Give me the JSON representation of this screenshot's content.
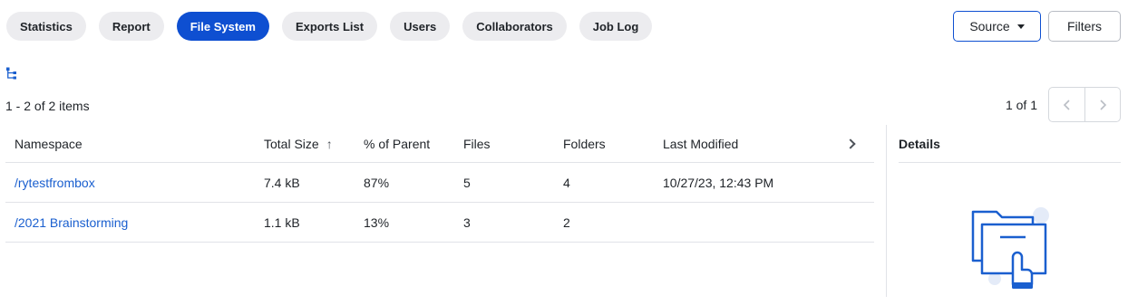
{
  "tabs": [
    {
      "label": "Statistics",
      "active": false
    },
    {
      "label": "Report",
      "active": false
    },
    {
      "label": "File System",
      "active": true
    },
    {
      "label": "Exports List",
      "active": false
    },
    {
      "label": "Users",
      "active": false
    },
    {
      "label": "Collaborators",
      "active": false
    },
    {
      "label": "Job Log",
      "active": false
    }
  ],
  "toolbar": {
    "source_label": "Source",
    "filters_label": "Filters"
  },
  "list": {
    "count_text": "1 - 2 of 2 items",
    "page_text": "1 of 1"
  },
  "table": {
    "columns": [
      "Namespace",
      "Total Size",
      "% of Parent",
      "Files",
      "Folders",
      "Last Modified"
    ],
    "rows": [
      {
        "namespace": "/rytestfrombox",
        "size": "7.4 kB",
        "pct": "87%",
        "files": "5",
        "folders": "4",
        "modified": "10/27/23, 12:43 PM"
      },
      {
        "namespace": "/2021 Brainstorming",
        "size": "1.1 kB",
        "pct": "13%",
        "files": "3",
        "folders": "2",
        "modified": ""
      }
    ]
  },
  "details": {
    "title": "Details"
  },
  "icons": {
    "tree": "tree-hierarchy-icon",
    "sort": "sort-ascending-icon",
    "expand": "chevron-right-icon"
  },
  "colors": {
    "accent": "#0e4fd1",
    "link": "#1a5fcf",
    "tab_bg": "#ececef"
  }
}
